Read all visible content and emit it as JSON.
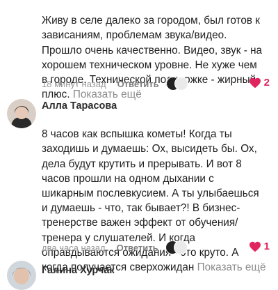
{
  "comments": [
    {
      "text_lines": "Живу в селе далеко за городом, был готов к\nзависаниям, проблемам звука/видео.\nПрошло очень качественно. Видео, звук - на\nхорошем техническом уровне. Не хуже чем\nв городе. Технической поддержке - жирный\nплюс.",
      "more_label": "Показать ещё",
      "time": "18 минут назад",
      "reply_label": "Ответить",
      "likes": "2"
    },
    {
      "author": "Алла Тарасова",
      "text_lines": "8 часов как вспышка кометы! Когда ты\nзаходишь и думаешь: Ох, высидеть бы. Ох,\nдела будут крутить и прерывать. И вот 8\nчасов прошли на одном дыхании с\nшикарным послевкусием. А ты улыбаешься\nи думаешь - что, так бывает?! В бизнес-\nтренерстве важен эффект от обучения/\nтренера у слушателей. И когда\nоправдываются ожидания - это круто. А\nкогда получается сверхожидан",
      "more_label": "Показать ещё",
      "time": "два часа назад",
      "reply_label": "Ответить",
      "likes": "1"
    },
    {
      "author": "Галина Хурчак"
    }
  ],
  "colors": {
    "accent": "#e0245e",
    "muted": "#9a9a9a"
  }
}
